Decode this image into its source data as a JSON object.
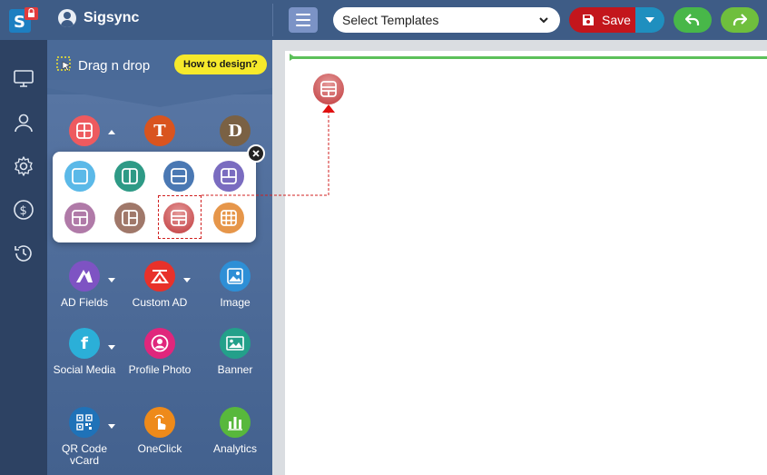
{
  "app": {
    "brand_name": "Sigsync"
  },
  "toolbar": {
    "template_select": "Select Templates",
    "save_label": "Save"
  },
  "panel": {
    "title": "Drag n drop",
    "howto_label": "How to design?",
    "tools": [
      {
        "label": "",
        "icon": "layout-icon",
        "color": "#ee5a5f"
      },
      {
        "label": "",
        "icon": "text-icon",
        "glyph": "T",
        "color": "#d9541f"
      },
      {
        "label": "",
        "icon": "divider-icon",
        "glyph": "D",
        "color": "#7a6144"
      },
      {
        "label": "AD Fields",
        "icon": "ad-fields-icon",
        "color": "#7e53c3"
      },
      {
        "label": "Custom AD",
        "icon": "custom-ad-icon",
        "color": "#e8312a"
      },
      {
        "label": "Image",
        "icon": "image-icon",
        "color": "#2e8fd6"
      },
      {
        "label": "Social Media",
        "icon": "facebook-icon",
        "glyph": "f",
        "color": "#2bafd8"
      },
      {
        "label": "Profile Photo",
        "icon": "profile-photo-icon",
        "color": "#e0267c"
      },
      {
        "label": "Banner",
        "icon": "banner-icon",
        "color": "#23a08a"
      },
      {
        "label": "QR Code vCard",
        "icon": "qr-code-icon",
        "color": "#1f72b8"
      },
      {
        "label": "OneClick",
        "icon": "oneclick-icon",
        "color": "#ee8a1a"
      },
      {
        "label": "Analytics",
        "icon": "analytics-icon",
        "color": "#58b83c"
      }
    ]
  },
  "layouts": [
    {
      "name": "layout-single",
      "color": "#5bb9e8"
    },
    {
      "name": "layout-two-column",
      "color": "#2e9a86"
    },
    {
      "name": "layout-two-row",
      "color": "#4a78b3"
    },
    {
      "name": "layout-two-top-one-bottom",
      "color": "#7a6cc0"
    },
    {
      "name": "layout-one-top-two-bottom",
      "color": "#b07aa8"
    },
    {
      "name": "layout-one-left-two-right",
      "color": "#a0786a"
    },
    {
      "name": "layout-three-row",
      "color": "#c0393b"
    },
    {
      "name": "layout-grid",
      "color": "#e6964a"
    }
  ],
  "colors": {
    "topbar": "#3e5c86",
    "rail": "#2d4263",
    "save": "#c3161c",
    "save_dropdown": "#1f8fbf",
    "undo": "#48b749",
    "redo": "#6fbf3d",
    "highlight": "#f6e92b",
    "canvas_guide": "#5cc05a",
    "connector": "#d02020"
  }
}
